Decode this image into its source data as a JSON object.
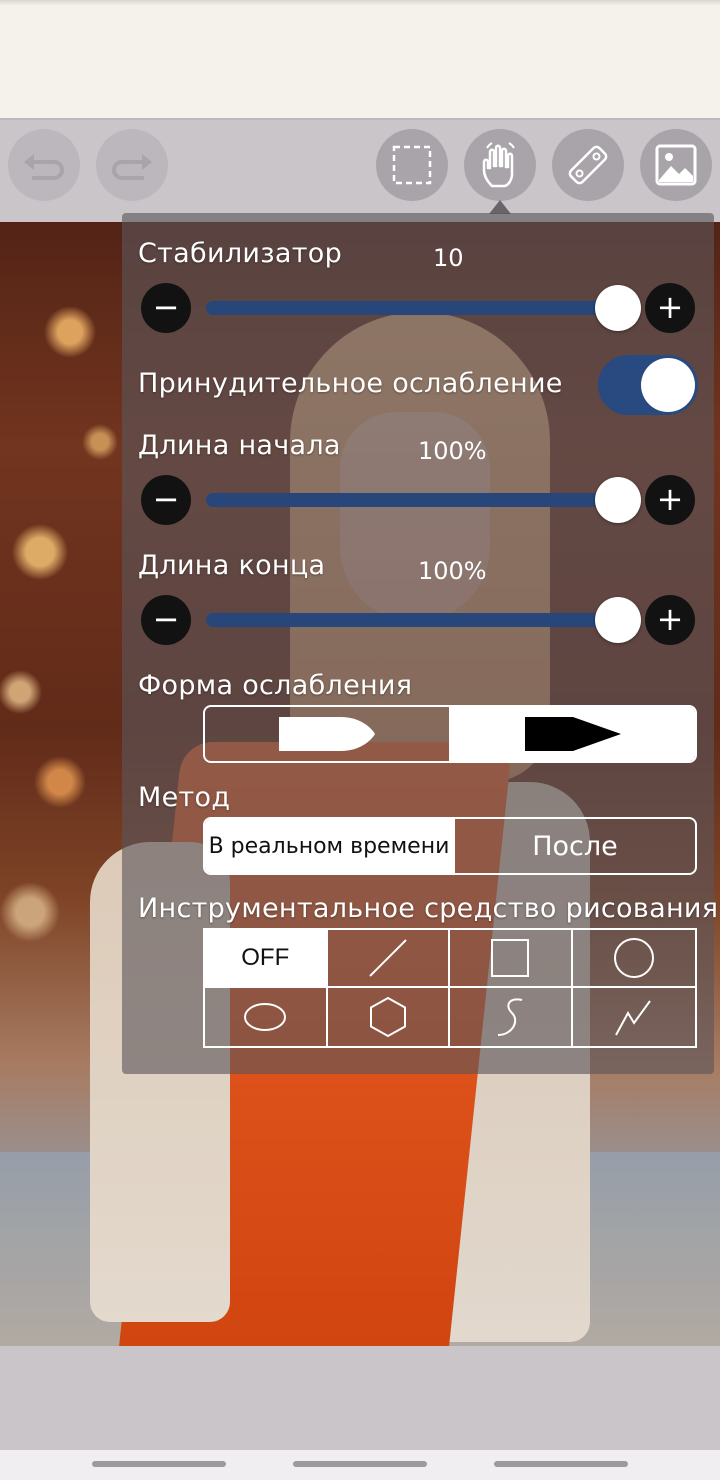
{
  "toolbar": {
    "buttons": [
      {
        "name": "undo",
        "icon": "undo-icon"
      },
      {
        "name": "redo",
        "icon": "redo-icon"
      },
      {
        "name": "selection",
        "icon": "selection-icon"
      },
      {
        "name": "hand",
        "icon": "hand-icon"
      },
      {
        "name": "ruler",
        "icon": "ruler-icon"
      },
      {
        "name": "image",
        "icon": "image-icon"
      }
    ]
  },
  "panel": {
    "stabilizer": {
      "label": "Стабилизатор",
      "value": "10",
      "level": 1.0
    },
    "forced_taper": {
      "label": "Принудительное ослабление",
      "on": true
    },
    "start_length": {
      "label": "Длина начала",
      "value": "100%",
      "level": 1.0
    },
    "end_length": {
      "label": "Длина конца",
      "value": "100%",
      "level": 1.0
    },
    "taper_shape": {
      "label": "Форма ослабления",
      "options": [
        "rounded-tip",
        "pointed-tip"
      ],
      "selected": "pointed-tip"
    },
    "method": {
      "label": "Метод",
      "options": [
        "В реальном времени",
        "После"
      ],
      "selected": "В реальном времени"
    },
    "drawing_tool": {
      "label": "Инструментальное средство рисования",
      "options": [
        "OFF",
        "line",
        "rectangle",
        "circle",
        "ellipse",
        "polygon",
        "curve",
        "polyline"
      ],
      "selected": "OFF"
    }
  },
  "colors": {
    "accent": "#27477a",
    "panel": "#5c565a",
    "toolbar": "#c9c5c9"
  }
}
